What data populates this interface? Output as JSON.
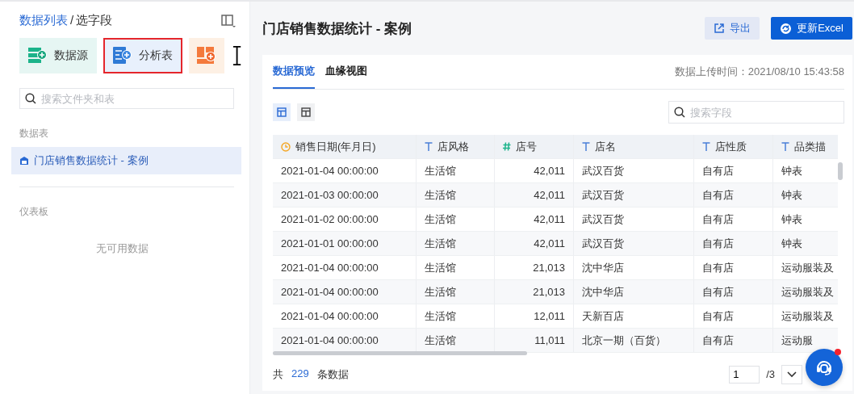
{
  "sidebar": {
    "breadcrumb": {
      "link": "数据列表",
      "separator": "/",
      "current": "选字段"
    },
    "create_buttons": [
      {
        "kind": "datasource",
        "label": "数据源",
        "highlighted": false
      },
      {
        "kind": "analysis",
        "label": "分析表",
        "highlighted": true
      },
      {
        "kind": "dashboard",
        "highlighted": false
      }
    ],
    "search": {
      "placeholder": "搜索文件夹和表"
    },
    "sections": [
      {
        "title": "数据表",
        "items": [
          {
            "label": "门店销售数据统计 - 案例",
            "selected": true
          }
        ]
      },
      {
        "title": "仪表板",
        "empty_text": "无可用数据"
      }
    ]
  },
  "header": {
    "title": "门店销售数据统计 - 案例",
    "buttons": [
      {
        "kind": "export",
        "label": "导出"
      },
      {
        "kind": "refresh",
        "label": "更新Excel"
      }
    ]
  },
  "tabs": [
    {
      "label": "数据预览",
      "selected": true
    },
    {
      "label": "血缘视图",
      "selected": false
    }
  ],
  "upload_time": "数据上传时间：2021/08/10 15:43:58",
  "view_toggles": [
    {
      "kind": "grid",
      "selected": true
    },
    {
      "kind": "layout",
      "selected": false
    }
  ],
  "field_search": {
    "placeholder": "搜索字段"
  },
  "table": {
    "columns": [
      {
        "label": "销售日期(年月日)",
        "kind": "date"
      },
      {
        "label": "店风格",
        "kind": "text"
      },
      {
        "label": "店号",
        "kind": "number"
      },
      {
        "label": "店名",
        "kind": "text"
      },
      {
        "label": "店性质",
        "kind": "text"
      },
      {
        "label": "品类描",
        "kind": "text"
      }
    ],
    "rows": [
      [
        "2021-01-04 00:00:00",
        "生活馆",
        "42,011",
        "武汉百货",
        "自有店",
        "钟表"
      ],
      [
        "2021-01-03 00:00:00",
        "生活馆",
        "42,011",
        "武汉百货",
        "自有店",
        "钟表"
      ],
      [
        "2021-01-02 00:00:00",
        "生活馆",
        "42,011",
        "武汉百货",
        "自有店",
        "钟表"
      ],
      [
        "2021-01-01 00:00:00",
        "生活馆",
        "42,011",
        "武汉百货",
        "自有店",
        "钟表"
      ],
      [
        "2021-01-04 00:00:00",
        "生活馆",
        "21,013",
        "沈中华店",
        "自有店",
        "运动服装及"
      ],
      [
        "2021-01-04 00:00:00",
        "生活馆",
        "21,013",
        "沈中华店",
        "自有店",
        "运动服装及"
      ],
      [
        "2021-01-04 00:00:00",
        "生活馆",
        "12,011",
        "天新百店",
        "自有店",
        "运动服装及"
      ],
      [
        "2021-01-04 00:00:00",
        "生活馆",
        "11,011",
        "北京一期（百货）",
        "自有店",
        "运动服"
      ]
    ]
  },
  "footer": {
    "total_prefix": "共",
    "total": "229",
    "total_suffix": "条数据",
    "page": "1",
    "page_count": "/3"
  }
}
